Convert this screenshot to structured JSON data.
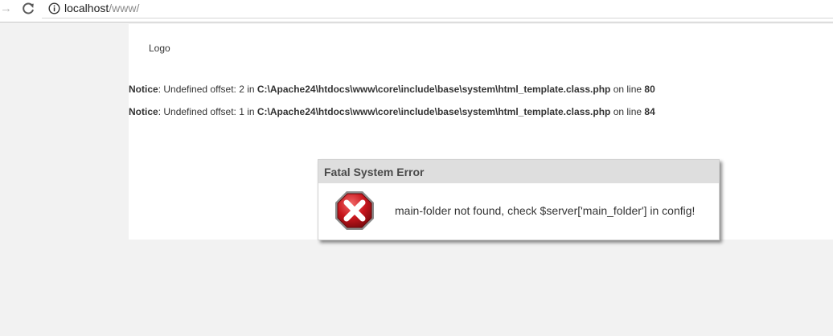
{
  "browser": {
    "url_host": "localhost",
    "url_path": "/www/",
    "forward_icon": "arrow-right-icon",
    "reload_icon": "reload-icon",
    "site_info_icon": "info-icon"
  },
  "page": {
    "logo_text": "Logo",
    "notices": [
      {
        "label": "Notice",
        "text_before": ": Undefined offset: 2 in ",
        "file": "C:\\Apache24\\htdocs\\www\\core\\include\\base\\system\\html_template.class.php",
        "text_mid": " on line ",
        "line": "80"
      },
      {
        "label": "Notice",
        "text_before": ": Undefined offset: 1 in ",
        "file": "C:\\Apache24\\htdocs\\www\\core\\include\\base\\system\\html_template.class.php",
        "text_mid": " on line ",
        "line": "84"
      }
    ]
  },
  "dialog": {
    "title": "Fatal System Error",
    "icon": "error-x-icon",
    "message": "main-folder not found, check $server['main_folder'] in config!"
  },
  "colors": {
    "page_background": "#f2f2f2",
    "content_background": "#ffffff",
    "dialog_header": "#dedede",
    "error_red": "#c8161d"
  }
}
